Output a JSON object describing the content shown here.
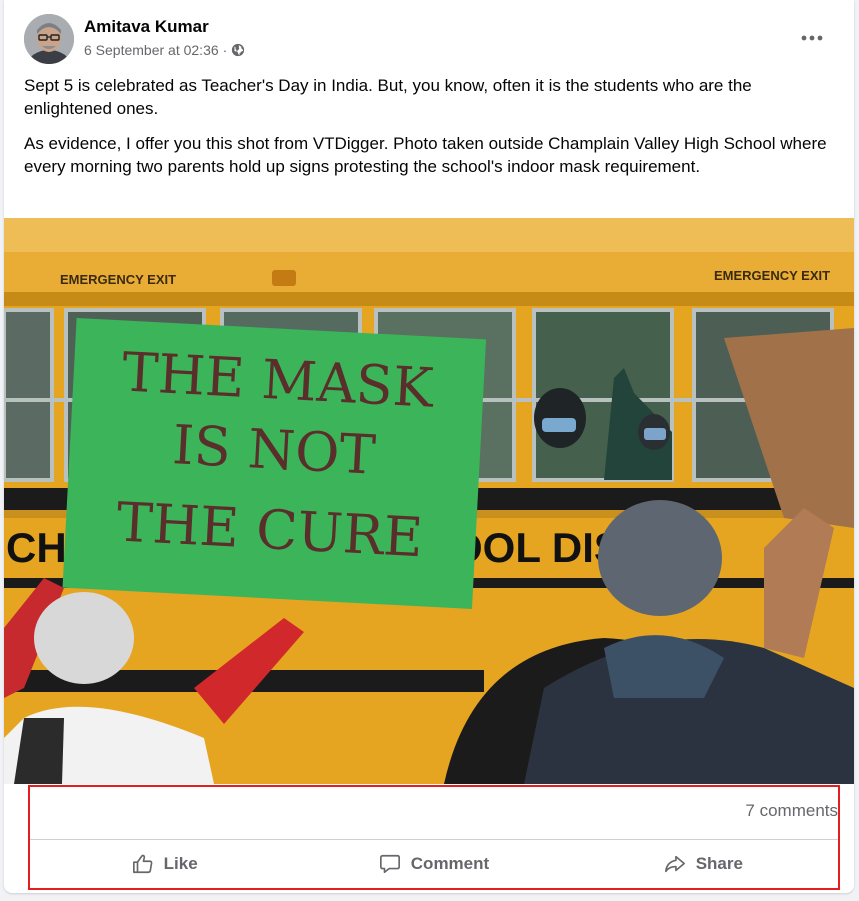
{
  "post": {
    "author": "Amitava Kumar",
    "timestamp": "6 September at 02:36",
    "separator": "·",
    "privacy_icon": "globe-icon",
    "more_icon": "more-dots-icon",
    "paragraphs": [
      "Sept 5 is celebrated as Teacher's Day in India. But, you know, often it is the students who are the enlightened ones.",
      "As evidence, I offer you this shot from VTDigger. Photo taken outside Champlain Valley High School where every morning two parents hold up signs protesting the school's indoor mask requirement."
    ]
  },
  "photo": {
    "sign_text": [
      "THE MASK",
      "IS NOT",
      "THE CURE"
    ],
    "bus_text_left": "EMERGENCY EXIT",
    "bus_text_right": "EMERGENCY EXIT",
    "bus_side_left": "CHA",
    "bus_side_right": "OOL DIST"
  },
  "footer": {
    "comments": "7 comments",
    "like_label": "Like",
    "comment_label": "Comment",
    "share_label": "Share",
    "like_icon": "thumbs-up-icon",
    "comment_icon": "comment-bubble-icon",
    "share_icon": "share-arrow-icon"
  },
  "colors": {
    "highlight_border": "#e41e1e",
    "bus_yellow": "#e5a520",
    "sign_green": "#3db55a"
  }
}
